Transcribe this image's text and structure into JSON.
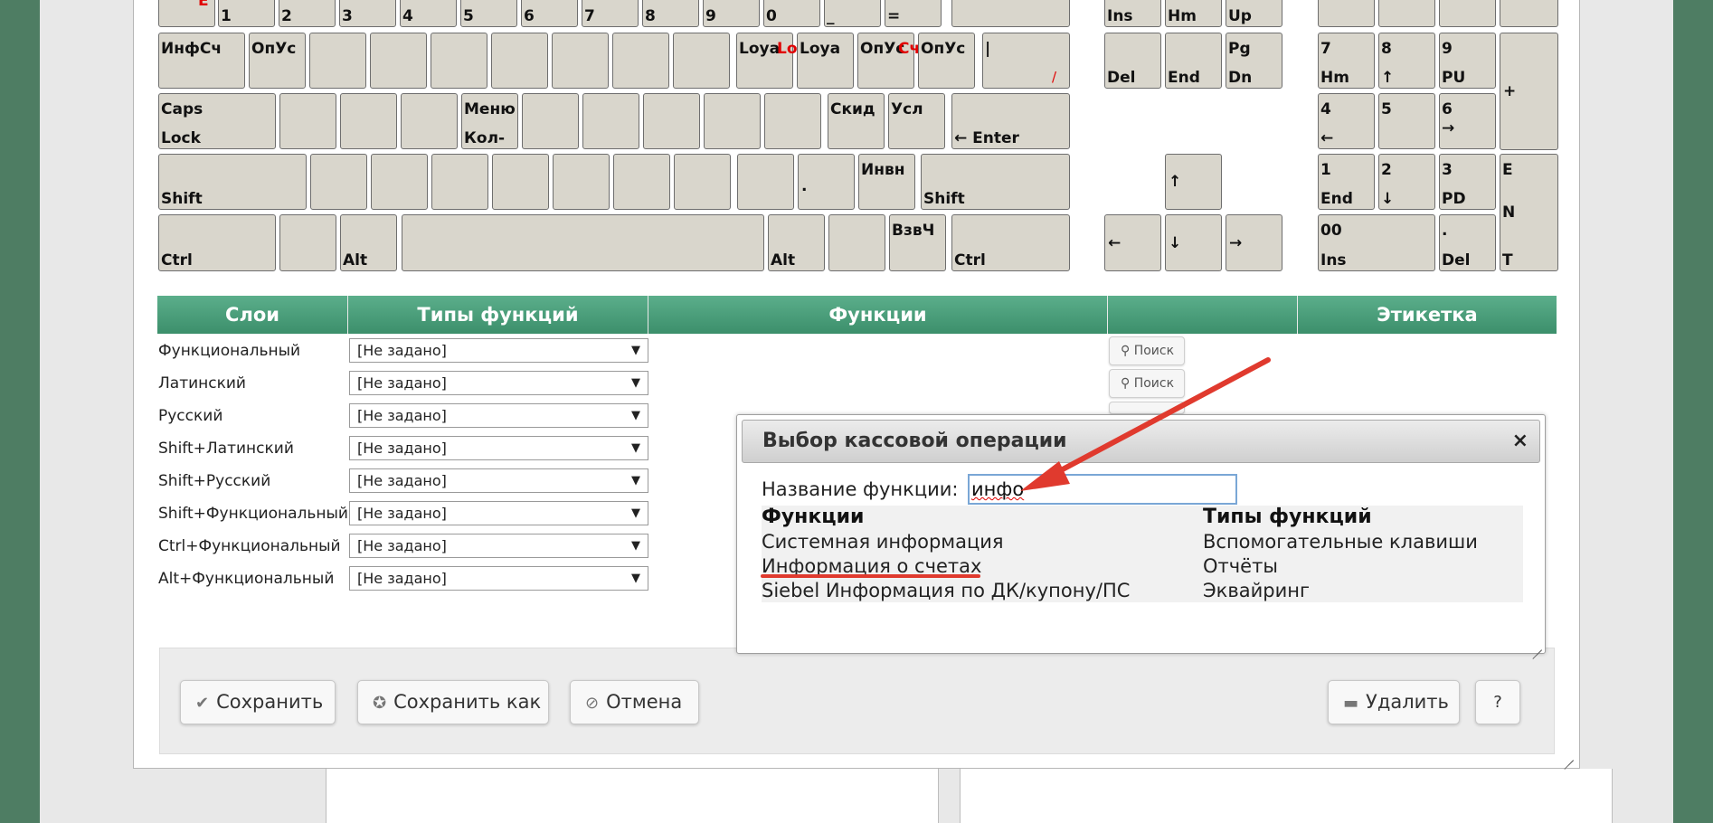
{
  "keyboard": {
    "row1": [
      "Ё",
      "1",
      "2",
      "3",
      "4",
      "5",
      "6",
      "7",
      "8",
      "9",
      "0",
      "_",
      "=",
      "←"
    ],
    "nav_top": [
      "Ins",
      "Hm",
      "Up"
    ],
    "row2": {
      "k1": "ИнфСч",
      "k2": "ОпУс",
      "k3": "Loya",
      "k3_red": "Lo",
      "k4": "Loya",
      "k5": "ОпУс",
      "k5_red": "Сч",
      "k6": "ОпУс",
      "k7_top": "|",
      "k7_mark": "/"
    },
    "nav_mid": [
      {
        "t": "",
        "b": "Del"
      },
      {
        "t": "",
        "b": "End"
      },
      {
        "t": "Pg",
        "b": "Dn"
      }
    ],
    "row3": {
      "caps_t": "Caps",
      "caps_b": "Lock",
      "menu_t": "Меню",
      "menu_b": "Кол-",
      "skid": "Скид",
      "usl": "Усл",
      "enter": "← Enter"
    },
    "row4": {
      "shift_l": "Shift",
      "dot": ".",
      "invn": "Инвн",
      "shift_r": "Shift"
    },
    "row5": {
      "ctrl_l": "Ctrl",
      "alt_l": "Alt",
      "alt_r": "Alt",
      "vzvch": "ВзвЧ",
      "ctrl_r": "Ctrl"
    },
    "arrows": {
      "up": "↑",
      "left": "←",
      "down": "↓",
      "right": "→"
    },
    "numpad": {
      "top": [
        "/",
        "*",
        "-"
      ],
      "n7_t": "7",
      "n7_b": "Hm",
      "n8_t": "8",
      "n8_b": "↑",
      "n9_t": "9",
      "n9_b": "PU",
      "plus": "+",
      "n4_t": "4",
      "n4_b": "←",
      "n5_t": "5",
      "n6_t": "6",
      "n6_b": "→",
      "n1_t": "1",
      "n1_b": "End",
      "n2_t": "2",
      "n2_b": "↓",
      "n3_t": "3",
      "n3_b": "PD",
      "enter_1": "E",
      "enter_2": "N",
      "enter_3": "T",
      "n0_t": "00",
      "n0_b": "Ins",
      "ndot_t": ".",
      "ndot_b": "Del"
    }
  },
  "table": {
    "headers": [
      "Слои",
      "Типы функций",
      "Функции",
      "",
      "Этикетка"
    ],
    "rows": [
      {
        "layer": "Функциональный",
        "type": "[Не задано]"
      },
      {
        "layer": "Латинский",
        "type": "[Не задано]"
      },
      {
        "layer": "Русский",
        "type": "[Не задано]"
      },
      {
        "layer": "Shift+Латинский",
        "type": "[Не задано]"
      },
      {
        "layer": "Shift+Русский",
        "type": "[Не задано]"
      },
      {
        "layer": "Shift+Функциональный",
        "type": "[Не задано]"
      },
      {
        "layer": "Ctrl+Функциональный",
        "type": "[Не задано]"
      },
      {
        "layer": "Alt+Функциональный",
        "type": "[Не задано]"
      }
    ],
    "search_label": "Поиск",
    "select_arrow": "▼"
  },
  "footer": {
    "save": "Сохранить",
    "save_as": "Сохранить как",
    "cancel": "Отмена",
    "delete": "Удалить",
    "help": "?"
  },
  "dialog": {
    "title": "Выбор кассовой операции",
    "close": "×",
    "name_label": "Название функции:",
    "name_value": "инфо",
    "col_functions": "Функции",
    "col_types": "Типы функций",
    "results": [
      {
        "function": "Системная информация",
        "type": "Вспомогательные клавиши"
      },
      {
        "function": "Информация о счетах",
        "type": "Отчёты"
      },
      {
        "function": "Siebel Информация по ДК/купону/ПС",
        "type": "Эквайринг"
      }
    ]
  },
  "colors": {
    "header_green": "#4a9f7b",
    "key_face": "#d9d6cc",
    "annotation_red": "#e03a2e",
    "outer_bg": "#4e7d63"
  }
}
